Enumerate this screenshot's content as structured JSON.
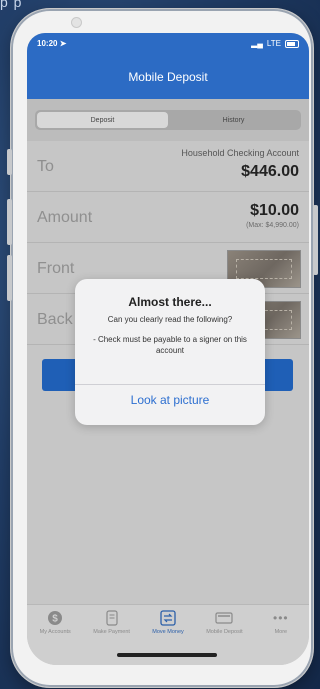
{
  "status": {
    "time": "10:20",
    "network": "LTE"
  },
  "header": {
    "title": "Mobile Deposit"
  },
  "segments": {
    "deposit": "Deposit",
    "history": "History"
  },
  "form": {
    "to": {
      "label": "To",
      "account": "Household Checking Account",
      "balance": "$446.00"
    },
    "amount": {
      "label": "Amount",
      "value": "$10.00",
      "max": "(Max: $4,990.00)"
    },
    "front": {
      "label": "Front"
    },
    "back": {
      "label": "Back"
    }
  },
  "dialog": {
    "title": "Almost there...",
    "message": "Can you clearly read the following?",
    "bullet": "- Check must be payable to a signer on this account",
    "action": "Look at picture"
  },
  "tabbar": {
    "items": [
      {
        "label": "My Accounts",
        "icon": "dollar-circle-icon",
        "active": false
      },
      {
        "label": "Make Payment",
        "icon": "phone-bill-icon",
        "active": false
      },
      {
        "label": "Move Money",
        "icon": "transfer-icon",
        "active": true
      },
      {
        "label": "Mobile Deposit",
        "icon": "check-card-icon",
        "active": false
      },
      {
        "label": "More",
        "icon": "ellipsis-icon",
        "active": false
      }
    ]
  },
  "colors": {
    "brand": "#2c6bc4",
    "link": "#2d6fd0",
    "active_tab": "#2b5fa9"
  }
}
